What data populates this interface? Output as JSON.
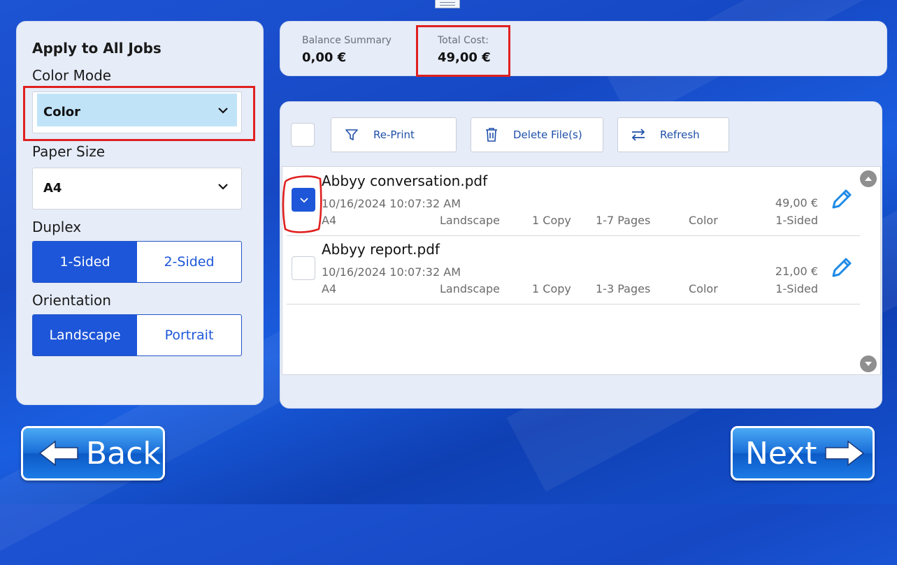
{
  "left_panel": {
    "heading": "Apply to All Jobs",
    "color_mode": {
      "label": "Color Mode",
      "value": "Color"
    },
    "paper_size": {
      "label": "Paper Size",
      "value": "A4"
    },
    "duplex": {
      "label": "Duplex",
      "options": [
        "1-Sided",
        "2-Sided"
      ],
      "selected": "1-Sided"
    },
    "orientation": {
      "label": "Orientation",
      "options": [
        "Landscape",
        "Portrait"
      ],
      "selected": "Landscape"
    }
  },
  "summary": {
    "balance_label": "Balance Summary",
    "balance_value": "0,00 €",
    "total_label": "Total Cost:",
    "total_value": "49,00 €"
  },
  "toolbar": {
    "reprint_label": "Re-Print",
    "delete_label": "Delete File(s)",
    "refresh_label": "Refresh"
  },
  "jobs": [
    {
      "name": "Abbyy conversation.pdf",
      "date": "10/16/2024 10:07:32 AM",
      "paper": "A4",
      "orientation": "Landscape",
      "copies": "1 Copy",
      "pages": "1-7 Pages",
      "color": "Color",
      "price": "49,00 €",
      "sided": "1-Sided",
      "selected": true
    },
    {
      "name": "Abbyy report.pdf",
      "date": "10/16/2024 10:07:32 AM",
      "paper": "A4",
      "orientation": "Landscape",
      "copies": "1 Copy",
      "pages": "1-3 Pages",
      "color": "Color",
      "price": "21,00 €",
      "sided": "1-Sided",
      "selected": false
    }
  ],
  "nav": {
    "back_label": "Back",
    "next_label": "Next"
  },
  "colors": {
    "accent": "#1d56d8",
    "highlight": "#e02020",
    "panel": "#e6ecf8"
  }
}
